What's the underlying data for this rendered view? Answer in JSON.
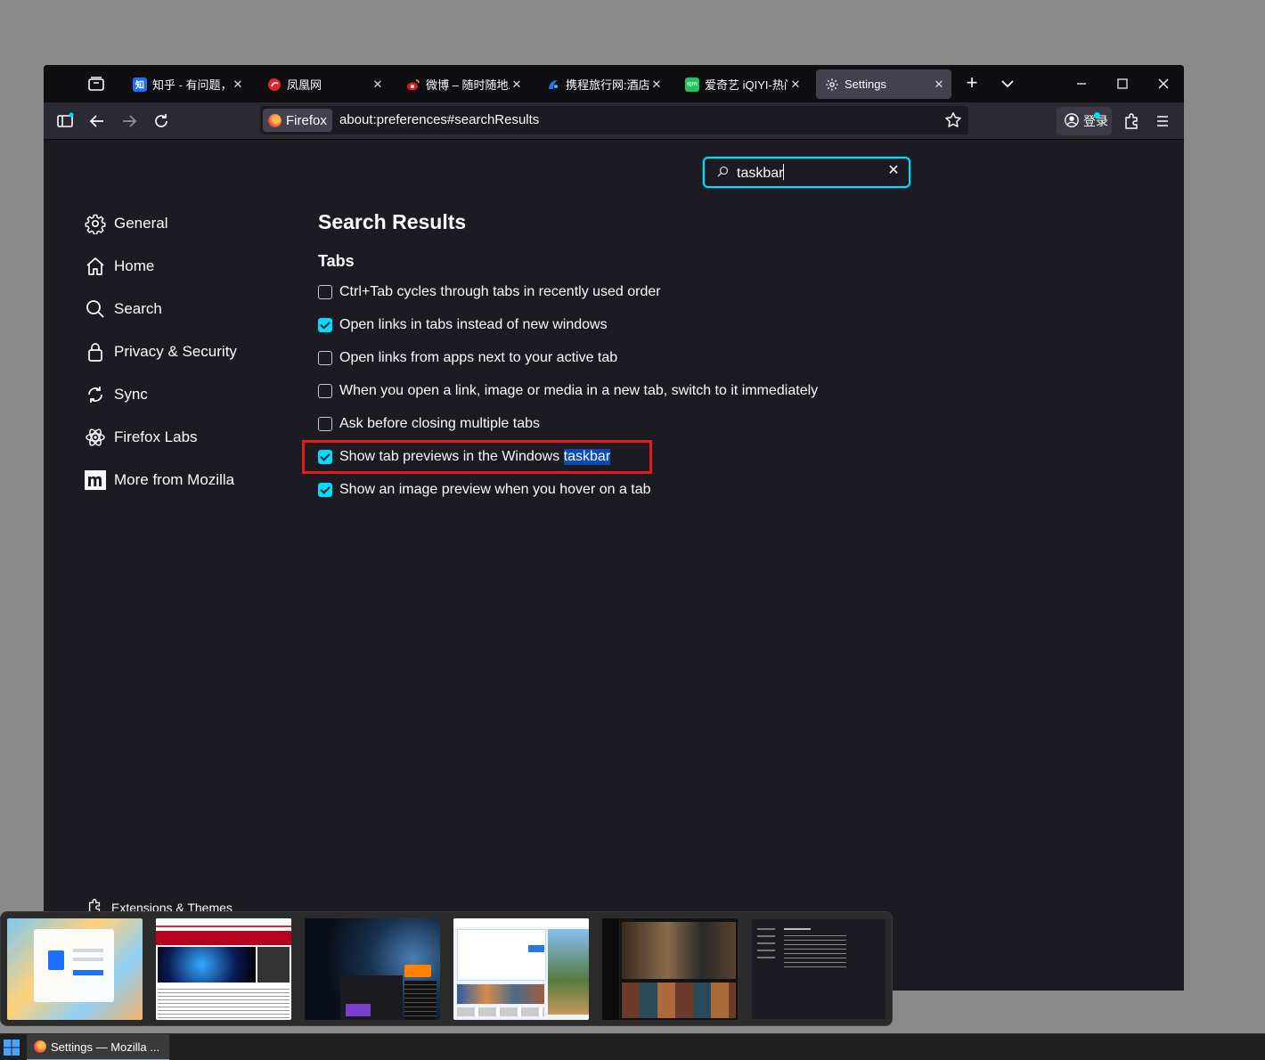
{
  "tabs": [
    {
      "title": "知乎 - 有问题，就",
      "favicon_text": "知",
      "favicon_color": "#1e6fff"
    },
    {
      "title": "凤凰网",
      "favicon_color": "#e0262b"
    },
    {
      "title": "微博 – 随时随地发",
      "favicon_color": "#e6162d"
    },
    {
      "title": "携程旅行网:酒店预",
      "favicon_color": "#2577e3"
    },
    {
      "title": "爱奇艺 iQIYI-热门",
      "favicon_text": "iQIYI",
      "favicon_color": "#1fc45c"
    },
    {
      "title": "Settings",
      "active": true
    }
  ],
  "navbar": {
    "identity_label": "Firefox",
    "url": "about:preferences#searchResults",
    "account_label": "登录"
  },
  "search": {
    "value": "taskbar"
  },
  "sidebar": {
    "items": [
      {
        "label": "General",
        "icon": "gear-icon"
      },
      {
        "label": "Home",
        "icon": "home-icon"
      },
      {
        "label": "Search",
        "icon": "search-icon"
      },
      {
        "label": "Privacy & Security",
        "icon": "lock-icon"
      },
      {
        "label": "Sync",
        "icon": "sync-icon"
      },
      {
        "label": "Firefox Labs",
        "icon": "atom-icon"
      },
      {
        "label": "More from Mozilla",
        "icon": "mozilla-icon"
      }
    ],
    "extensions_label": "Extensions & Themes"
  },
  "results": {
    "heading": "Search Results",
    "section": "Tabs",
    "options": [
      {
        "label": "Ctrl+Tab cycles through tabs in recently used order",
        "checked": false
      },
      {
        "label": "Open links in tabs instead of new windows",
        "checked": true
      },
      {
        "label": "Open links from apps next to your active tab",
        "checked": false
      },
      {
        "label": "When you open a link, image or media in a new tab, switch to it immediately",
        "checked": false
      },
      {
        "label": "Ask before closing multiple tabs",
        "checked": false
      },
      {
        "label_pre": "Show tab previews in the Windows ",
        "label_highlight": "taskbar",
        "checked": true
      },
      {
        "label": "Show an image preview when you hover on a tab",
        "checked": true
      }
    ]
  },
  "taskbar": {
    "item_label": "Settings — Mozilla ..."
  },
  "colors": {
    "accent": "#00ddff",
    "highlight_box": "#e31b1b",
    "background": "#1c1b22"
  }
}
